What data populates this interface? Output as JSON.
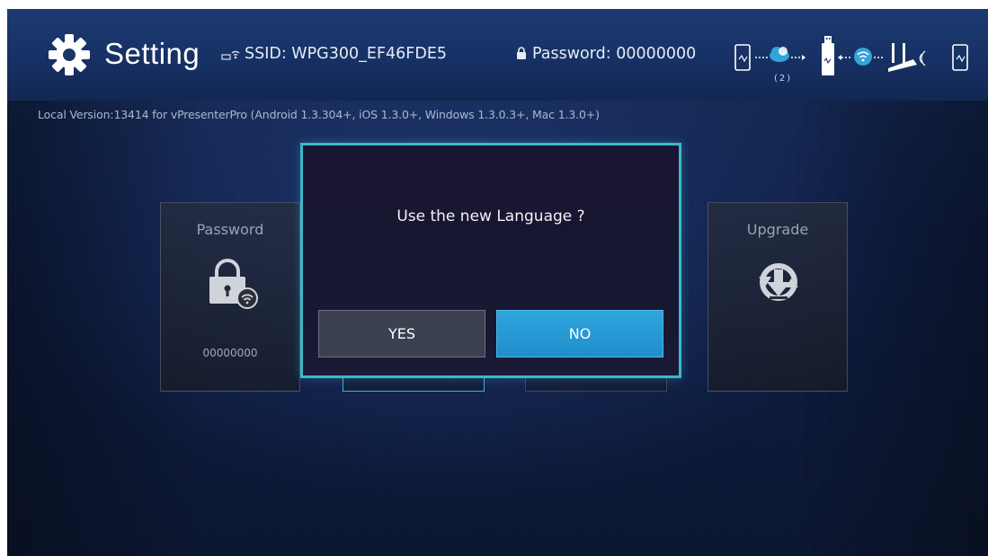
{
  "header": {
    "title": "Setting",
    "ssid_text": "SSID: WPG300_EF46FDE5",
    "password_text": "Password: 00000000",
    "diagram_label": "(2)"
  },
  "version_text": "Local Version:13414 for vPresenterPro (Android 1.3.304+, iOS 1.3.0+, Windows 1.3.0.3+, Mac 1.3.0+)",
  "cards": [
    {
      "title": "Password",
      "value": "00000000",
      "icon": "lock-wifi-icon"
    },
    {
      "title": "Upgrade",
      "icon": "upgrade-icon"
    }
  ],
  "dialog": {
    "message": "Use the new Language ?",
    "yes_label": "YES",
    "no_label": "NO",
    "selected": "NO"
  },
  "colors": {
    "accent": "#3cb8cb",
    "button_selected": "#2fa4dd",
    "header_bg": "#1c3a72"
  }
}
